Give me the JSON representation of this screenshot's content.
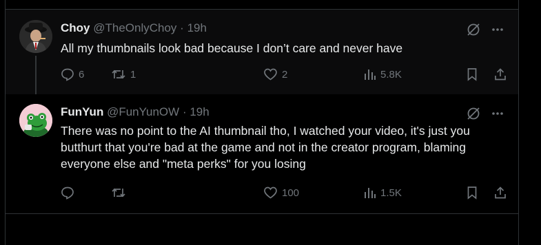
{
  "tweets": [
    {
      "name": "Choy",
      "handle": "@TheOnlyChoy",
      "separator": "·",
      "time": "19h",
      "text": "All my thumbnails look bad because I don’t care and never have",
      "replies": "6",
      "retweets": "1",
      "likes": "2",
      "views": "5.8K"
    },
    {
      "name": "FunYun",
      "handle": "@FunYunOW",
      "separator": "·",
      "time": "19h",
      "text": "There was no point to the AI thumbnail tho, I watched your video, it's just you butthurt that you're bad at the game and not in the creator program, blaming everyone else and \"meta perks\" for you losing",
      "replies": "",
      "retweets": "",
      "likes": "100",
      "views": "1.5K"
    }
  ],
  "icons": {
    "grok": "grok-icon",
    "more": "more-icon",
    "reply": "reply-icon",
    "retweet": "retweet-icon",
    "like": "heart-icon",
    "views": "views-icon",
    "bookmark": "bookmark-icon",
    "share": "share-icon"
  },
  "colors": {
    "background": "#000000",
    "thread_highlight": "#0b0b0c",
    "text": "#e7e9ea",
    "muted": "#71767b",
    "border": "#2f3336"
  }
}
